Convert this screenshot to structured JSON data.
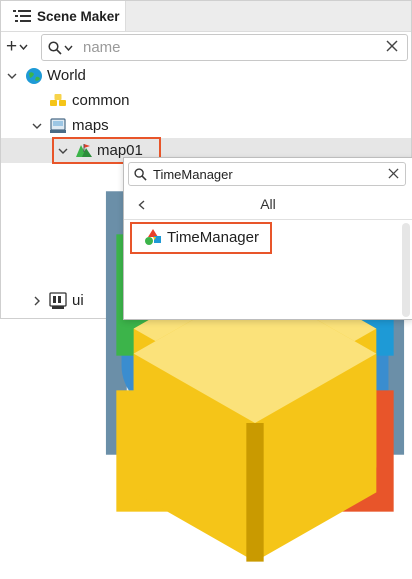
{
  "panel": {
    "title": "Scene Maker",
    "icon": "list-icon"
  },
  "toolbar": {
    "add_label": "+",
    "search_placeholder": "name",
    "search_value": ""
  },
  "tree": [
    {
      "label": "World",
      "icon": "globe-icon",
      "expanded": true
    },
    {
      "label": "common",
      "icon": "common-folder-icon"
    },
    {
      "label": "maps",
      "icon": "maps-icon",
      "expanded": true
    },
    {
      "label": "map01",
      "icon": "map-icon",
      "expanded": true,
      "selected": true
    },
    {
      "label": "ui",
      "icon": "ui-icon",
      "expanded": false
    }
  ],
  "popup": {
    "search_value": "TimeManager",
    "category": "All",
    "items": [
      {
        "label": "TimeManager",
        "icon": "time-manager-icon"
      }
    ]
  },
  "colors": {
    "highlight": "#e8552a",
    "selected_row": "#e6e6e6"
  }
}
